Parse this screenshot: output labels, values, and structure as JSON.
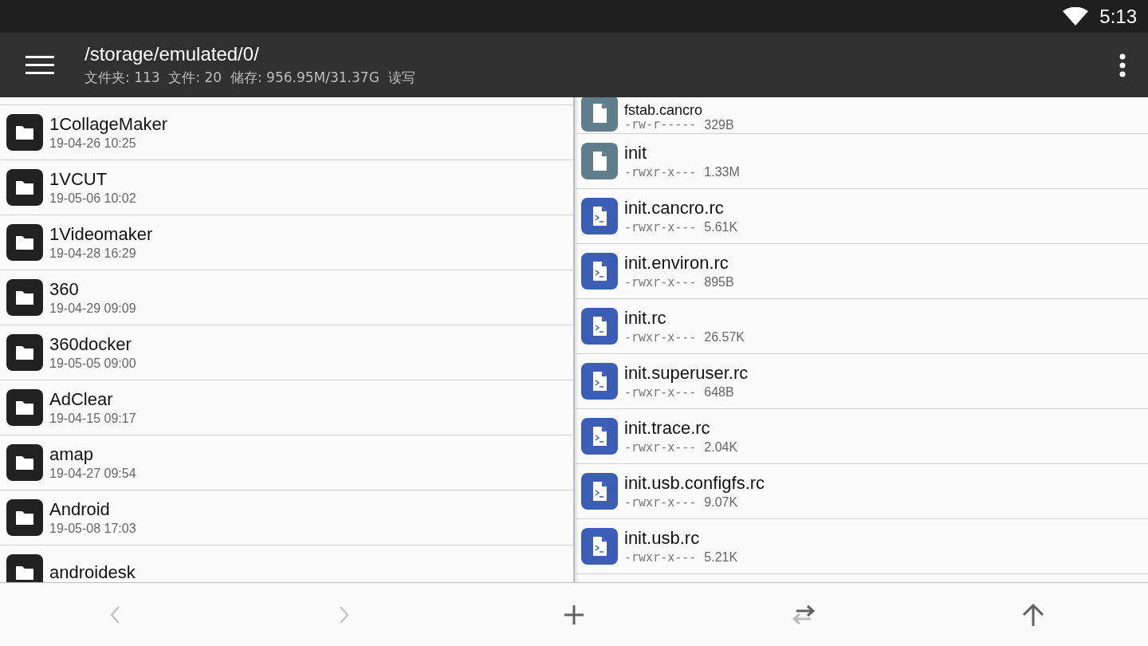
{
  "status_bar": {
    "time": "5:13"
  },
  "toolbar": {
    "title": "/storage/emulated/0/",
    "subtitle": "文件夹: 113  文件: 20  储存: 956.95M/31.37G  读写"
  },
  "left_pane": {
    "items": [
      {
        "kind": "folder",
        "name": "1CollageMaker",
        "meta": "19-04-26 10:25"
      },
      {
        "kind": "folder",
        "name": "1VCUT",
        "meta": "19-05-06 10:02"
      },
      {
        "kind": "folder",
        "name": "1Videomaker",
        "meta": "19-04-28 16:29"
      },
      {
        "kind": "folder",
        "name": "360",
        "meta": "19-04-29 09:09"
      },
      {
        "kind": "folder",
        "name": "360docker",
        "meta": "19-05-05 09:00"
      },
      {
        "kind": "folder",
        "name": "AdClear",
        "meta": "19-04-15 09:17"
      },
      {
        "kind": "folder",
        "name": "amap",
        "meta": "19-04-27 09:54"
      },
      {
        "kind": "folder",
        "name": "Android",
        "meta": "19-05-08 17:03"
      },
      {
        "kind": "folder",
        "name": "androidesk"
      }
    ]
  },
  "right_pane": {
    "items": [
      {
        "kind": "file",
        "name": "fstab.cancro",
        "perms": "-rw-r-----",
        "size": "329B"
      },
      {
        "kind": "file",
        "name": "init",
        "perms": "-rwxr-x---",
        "size": "1.33M"
      },
      {
        "kind": "script",
        "name": "init.cancro.rc",
        "perms": "-rwxr-x---",
        "size": "5.61K"
      },
      {
        "kind": "script",
        "name": "init.environ.rc",
        "perms": "-rwxr-x---",
        "size": "895B"
      },
      {
        "kind": "script",
        "name": "init.rc",
        "perms": "-rwxr-x---",
        "size": "26.57K"
      },
      {
        "kind": "script",
        "name": "init.superuser.rc",
        "perms": "-rwxr-x---",
        "size": "648B"
      },
      {
        "kind": "script",
        "name": "init.trace.rc",
        "perms": "-rwxr-x---",
        "size": "2.04K"
      },
      {
        "kind": "script",
        "name": "init.usb.configfs.rc",
        "perms": "-rwxr-x---",
        "size": "9.07K"
      },
      {
        "kind": "script",
        "name": "init.usb.rc",
        "perms": "-rwxr-x---",
        "size": "5.21K"
      }
    ]
  },
  "bottom_bar": [
    {
      "kind": "back",
      "disabled": true
    },
    {
      "kind": "forward",
      "disabled": true
    },
    {
      "kind": "add",
      "disabled": false
    },
    {
      "kind": "swap",
      "disabled": false
    },
    {
      "kind": "up",
      "disabled": false
    }
  ]
}
